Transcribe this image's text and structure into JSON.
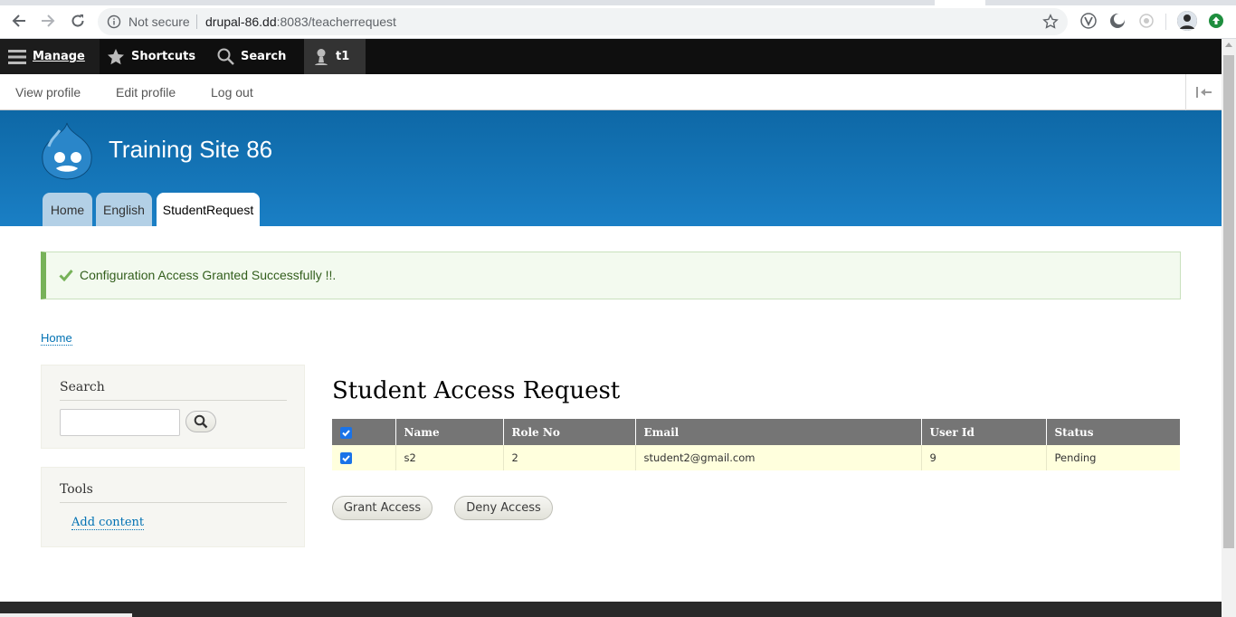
{
  "browser": {
    "security_label": "Not secure",
    "url_host": "drupal-86.dd",
    "url_path": ":8083/teacherrequest"
  },
  "toolbar": {
    "manage_label": "Manage",
    "shortcuts_label": "Shortcuts",
    "search_label": "Search",
    "user_label": "t1"
  },
  "tray": {
    "links": [
      "View profile",
      "Edit profile",
      "Log out"
    ]
  },
  "site": {
    "name": "Training Site 86"
  },
  "primary_tabs": [
    {
      "label": "Home",
      "active": false
    },
    {
      "label": "English",
      "active": false
    },
    {
      "label": "StudentRequest",
      "active": true
    }
  ],
  "status_message": "Configuration Access Granted Successfully !!.",
  "breadcrumb": "Home",
  "sidebar": {
    "search_title": "Search",
    "tools_title": "Tools",
    "tools_link": "Add content"
  },
  "main": {
    "title": "Student Access Request",
    "columns": [
      "Name",
      "Role No",
      "Email",
      "User Id",
      "Status"
    ],
    "rows": [
      {
        "checked": true,
        "name": "s2",
        "role_no": "2",
        "email": "student2@gmail.com",
        "user_id": "9",
        "status": "Pending"
      }
    ],
    "grant_label": "Grant Access",
    "deny_label": "Deny Access"
  },
  "colors": {
    "header_blue": "#1a7fc5",
    "link": "#0071b3",
    "status_green": "#77b259",
    "row_highlight": "#ffffdd"
  }
}
